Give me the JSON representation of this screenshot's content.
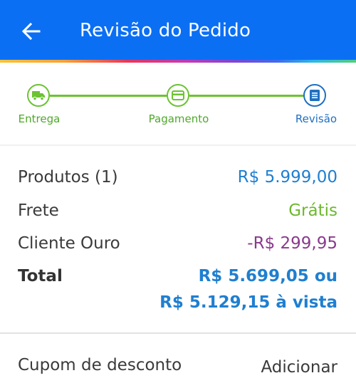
{
  "header": {
    "title": "Revisão do Pedido",
    "back_icon": "arrow-left-icon",
    "background_color": "#0b6ff4"
  },
  "stepper": {
    "steps": [
      {
        "label": "Entrega",
        "icon": "truck-icon",
        "state": "done"
      },
      {
        "label": "Pagamento",
        "icon": "credit-card-icon",
        "state": "done"
      },
      {
        "label": "Revisão",
        "icon": "receipt-icon",
        "state": "current"
      }
    ],
    "done_color": "#6cc332",
    "current_color": "#1f70c1"
  },
  "summary": {
    "products_label": "Produtos (1)",
    "products_value": "R$ 5.999,00",
    "shipping_label": "Frete",
    "shipping_value": "Grátis",
    "gold_label": "Cliente Ouro",
    "gold_value": "-R$ 299,95",
    "total_label": "Total",
    "total_value_line1": "R$ 5.699,05 ou",
    "total_value_line2": "R$ 5.129,15 à vista"
  },
  "coupon": {
    "label": "Cupom de desconto",
    "action_label": "Adicionar"
  }
}
